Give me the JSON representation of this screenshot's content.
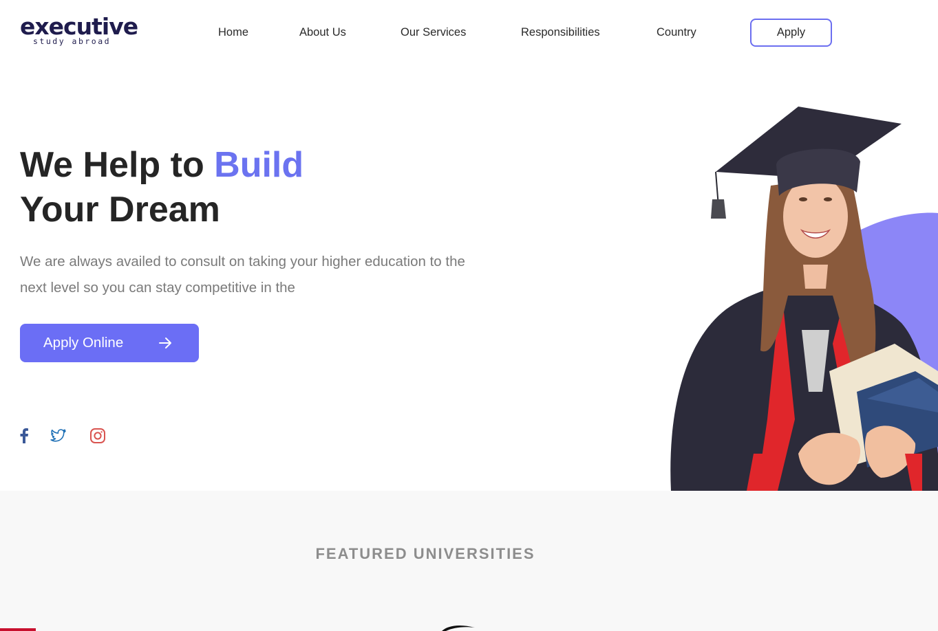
{
  "logo": {
    "main": "executive",
    "sub": "study abroad"
  },
  "nav": {
    "items": [
      {
        "label": "Home"
      },
      {
        "label": "About Us"
      },
      {
        "label": "Our Services"
      },
      {
        "label": "Responsibilities"
      },
      {
        "label": "Country"
      }
    ],
    "apply_label": "Apply"
  },
  "hero": {
    "title_part1": "We Help to ",
    "title_accent": "Build",
    "title_line2": "Your Dream",
    "description": "We are always availed to consult on taking your higher education to the next level so you can stay competitive in the",
    "cta_label": "Apply Online"
  },
  "social": {
    "icons": [
      "facebook-icon",
      "twitter-icon",
      "instagram-icon"
    ]
  },
  "featured": {
    "title": "FEATURED UNIVERSITIES"
  },
  "colors": {
    "accent": "#6b6ef5",
    "accent_text": "#6b73f0",
    "logo": "#1f1c4d",
    "facebook": "#3b5998",
    "twitter": "#1d6fb5",
    "instagram": "#d9534f",
    "section_bg": "#f8f8f8"
  }
}
